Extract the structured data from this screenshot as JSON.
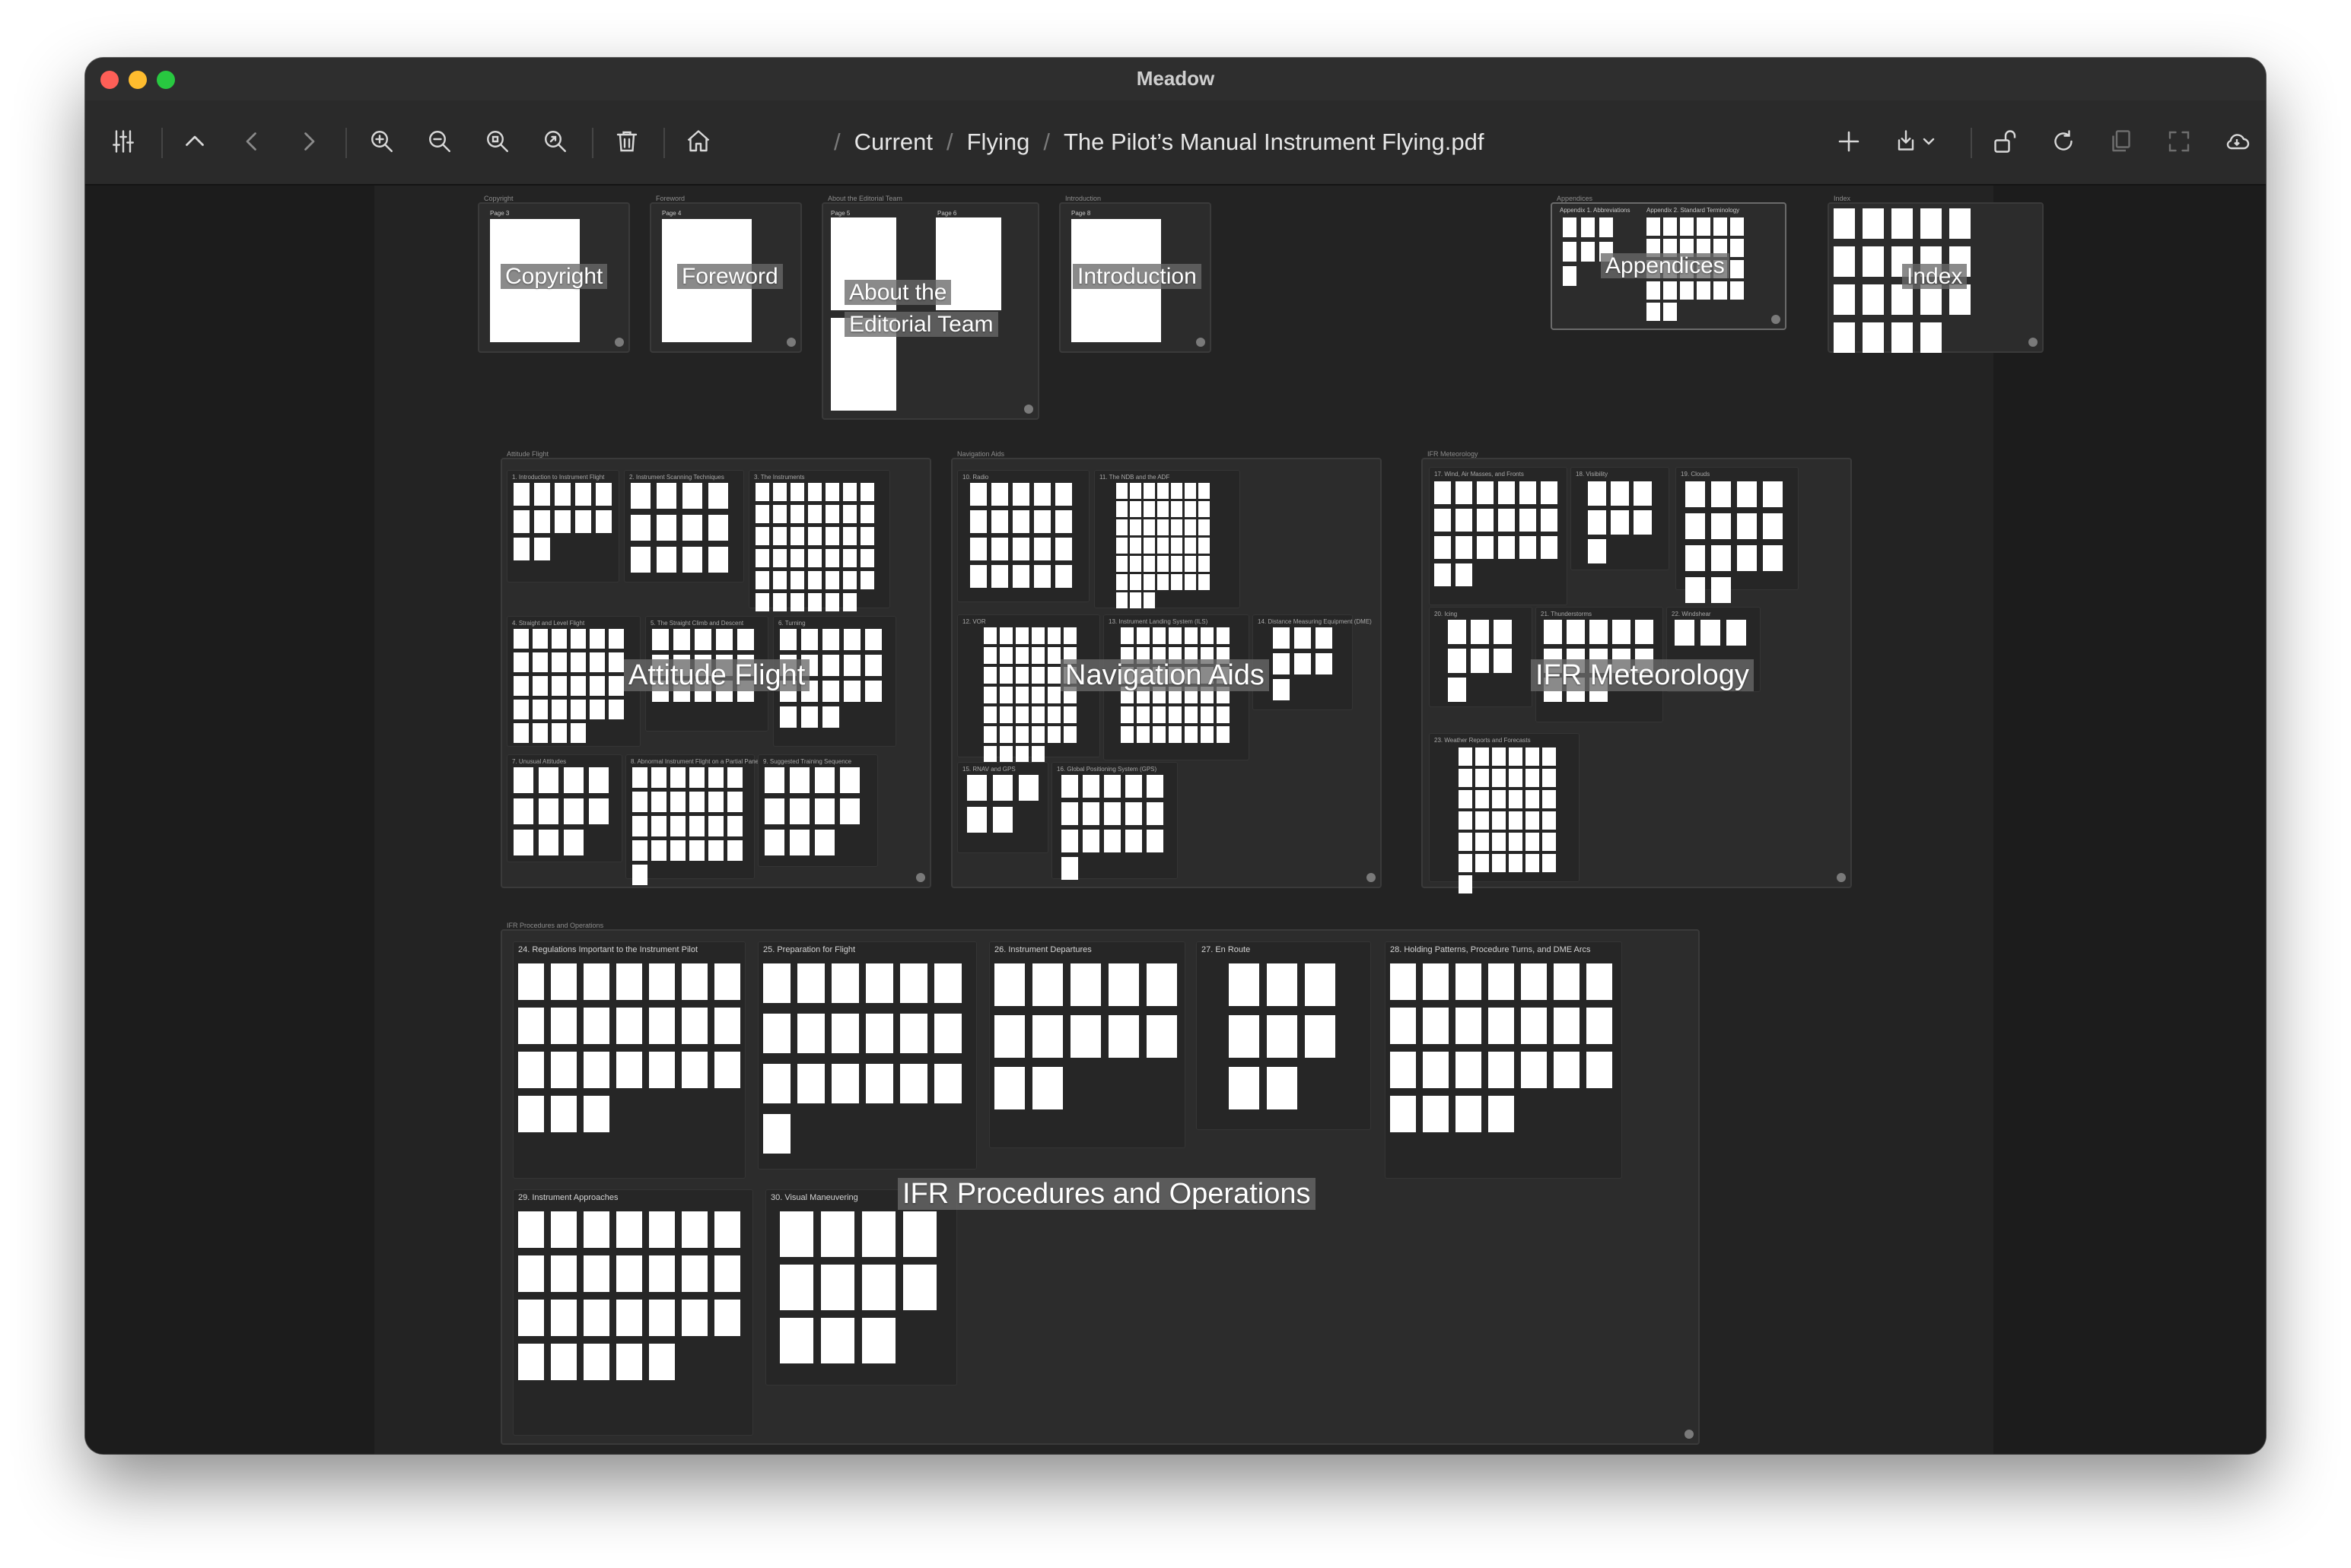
{
  "window": {
    "title": "Meadow"
  },
  "toolbar": {
    "icons": [
      "sliders-icon",
      "chevron-up-icon",
      "chevron-left-icon",
      "chevron-right-icon",
      "zoom-in-icon",
      "zoom-out-icon",
      "zoom-fit-icon",
      "zoom-actual-icon",
      "trash-icon",
      "home-icon",
      "plus-icon",
      "import-icon",
      "unlock-icon",
      "refresh-icon",
      "copy-icon",
      "fullscreen-icon",
      "cloud-icon"
    ]
  },
  "breadcrumb": {
    "items": [
      "Current",
      "Flying",
      "The Pilot’s Manual Instrument Flying.pdf"
    ]
  },
  "front_matter": {
    "copyright": {
      "caption": "Copyright",
      "page": "Page 3",
      "title": "Copyright"
    },
    "foreword": {
      "caption": "Foreword",
      "page": "Page 4",
      "title": "Foreword"
    },
    "editorial": {
      "caption": "About the Editorial Team",
      "page_a": "Page 5",
      "page_b": "Page 6",
      "title_line1": "About the",
      "title_line2": "Editorial Team"
    },
    "introduction": {
      "caption": "Introduction",
      "page": "Page 8",
      "title": "Introduction"
    },
    "appendices": {
      "caption": "Appendices",
      "sub_a": "Appendix 1. Abbreviations",
      "sub_b": "Appendix 2. Standard Terminology",
      "title": "Appendices"
    },
    "index": {
      "caption": "Index",
      "title": "Index"
    }
  },
  "attitude_flight": {
    "caption": "Attitude Flight",
    "title": "Attitude Flight",
    "chapters": [
      "1. Introduction to Instrument Flight",
      "2. Instrument Scanning Techniques",
      "3. The Instruments",
      "4. Straight and Level Flight",
      "5. The Straight Climb and Descent",
      "6. Turning",
      "7. Unusual Attitudes",
      "8. Abnormal Instrument Flight on a Partial Panel",
      "9. Suggested Training Sequence"
    ]
  },
  "navigation_aids": {
    "caption": "Navigation Aids",
    "title": "Navigation Aids",
    "chapters": [
      "10. Radio",
      "11. The NDB and the ADF",
      "12. VOR",
      "13. Instrument Landing System (ILS)",
      "14. Distance Measuring Equipment (DME)",
      "15. RNAV and GPS",
      "16. Global Positioning System (GPS)"
    ]
  },
  "ifr_meteorology": {
    "caption": "IFR Meteorology",
    "title": "IFR Meteorology",
    "chapters": [
      "17. Wind, Air Masses, and Fronts",
      "18. Visibility",
      "19. Clouds",
      "20. Icing",
      "21. Thunderstorms",
      "22. Windshear",
      "23. Weather Reports and Forecasts"
    ]
  },
  "ifr_procedures": {
    "caption": "IFR Procedures and Operations",
    "title": "IFR Procedures and Operations",
    "chapters": [
      "24. Regulations Important to the Instrument Pilot",
      "25. Preparation for Flight",
      "26. Instrument Departures",
      "27. En Route",
      "28. Holding Patterns, Procedure Turns, and DME Arcs",
      "29. Instrument Approaches",
      "30. Visual Maneuvering"
    ]
  }
}
